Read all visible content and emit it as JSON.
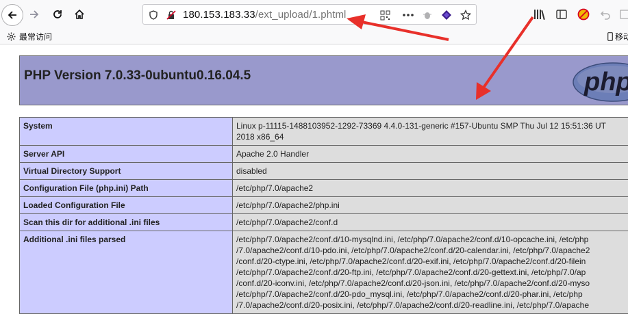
{
  "browser": {
    "url_host": "180.153.183.33",
    "url_path": "/ext_upload/1.phtml",
    "bookmark_label": "最常访问",
    "mobile_label": "移动"
  },
  "php": {
    "version_title": "PHP Version 7.0.33-0ubuntu0.16.04.5",
    "logo_text": "php"
  },
  "info_rows": [
    {
      "label": "System",
      "value": "Linux p-11115-1488103952-1292-73369 4.4.0-131-generic #157-Ubuntu SMP Thu Jul 12 15:51:36 UT\n2018 x86_64"
    },
    {
      "label": "Server API",
      "value": "Apache 2.0 Handler"
    },
    {
      "label": "Virtual Directory Support",
      "value": "disabled"
    },
    {
      "label": "Configuration File (php.ini) Path",
      "value": "/etc/php/7.0/apache2"
    },
    {
      "label": "Loaded Configuration File",
      "value": "/etc/php/7.0/apache2/php.ini"
    },
    {
      "label": "Scan this dir for additional .ini files",
      "value": "/etc/php/7.0/apache2/conf.d"
    },
    {
      "label": "Additional .ini files parsed",
      "value": "/etc/php/7.0/apache2/conf.d/10-mysqlnd.ini, /etc/php/7.0/apache2/conf.d/10-opcache.ini, /etc/php\n/7.0/apache2/conf.d/10-pdo.ini, /etc/php/7.0/apache2/conf.d/20-calendar.ini, /etc/php/7.0/apache2\n/conf.d/20-ctype.ini, /etc/php/7.0/apache2/conf.d/20-exif.ini, /etc/php/7.0/apache2/conf.d/20-filein\n/etc/php/7.0/apache2/conf.d/20-ftp.ini, /etc/php/7.0/apache2/conf.d/20-gettext.ini, /etc/php/7.0/ap\n/conf.d/20-iconv.ini, /etc/php/7.0/apache2/conf.d/20-json.ini, /etc/php/7.0/apache2/conf.d/20-myso\n/etc/php/7.0/apache2/conf.d/20-pdo_mysql.ini, /etc/php/7.0/apache2/conf.d/20-phar.ini, /etc/php\n/7.0/apache2/conf.d/20-posix.ini, /etc/php/7.0/apache2/conf.d/20-readline.ini, /etc/php/7.0/apache"
    }
  ],
  "colors": {
    "header_bg": "#9999cc",
    "label_bg": "#ccccff",
    "value_bg": "#dddddd",
    "annotation_arrow": "#e8302a"
  }
}
